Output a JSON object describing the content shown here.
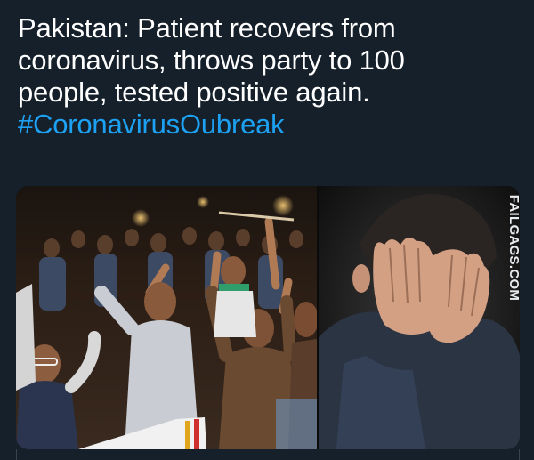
{
  "tweet": {
    "text_lines": [
      "Pakistan: Patient recovers from",
      "coronavirus, throws party to 100",
      "people, tested positive again."
    ],
    "hashtag": "#CoronavirusOubreak"
  },
  "media": {
    "left_photo": "crowd celebrating at night",
    "right_photo": "man covering face with hands"
  },
  "watermark": {
    "text": "FAILGAGS.COM"
  },
  "colors": {
    "background": "#15202b",
    "text": "#ffffff",
    "hashtag": "#1da1f2"
  }
}
